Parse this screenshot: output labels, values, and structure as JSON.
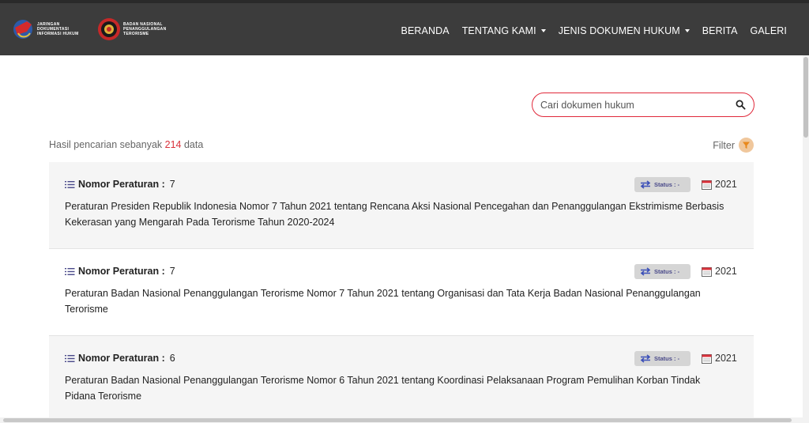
{
  "header": {
    "logo1_text": "JARINGAN DOKUMENTASI INFORMASI HUKUM",
    "logo2_text": "BADAN NASIONAL PENANGGULANGAN TERORISME",
    "nav": [
      "BERANDA",
      "TENTANG KAMI",
      "JENIS DOKUMEN HUKUM",
      "BERITA",
      "GALERI"
    ]
  },
  "search": {
    "placeholder": "Cari dokumen hukum"
  },
  "results": {
    "prefix": "Hasil pencarian sebanyak",
    "count": "214",
    "suffix": "data"
  },
  "filter": {
    "label": "Filter"
  },
  "cards": [
    {
      "label": "Nomor Peraturan :",
      "number": "7",
      "status": "Status : -",
      "year": "2021",
      "title": "Peraturan Presiden Republik Indonesia Nomor 7 Tahun 2021 tentang Rencana Aksi Nasional Pencegahan dan Penanggulangan Ekstrimisme Berbasis Kekerasan yang Mengarah Pada Terorisme Tahun 2020-2024"
    },
    {
      "label": "Nomor Peraturan :",
      "number": "7",
      "status": "Status : -",
      "year": "2021",
      "title": "Peraturan Badan Nasional Penanggulangan Terorisme Nomor 7 Tahun 2021 tentang Organisasi dan Tata Kerja Badan Nasional Penanggulangan Terorisme"
    },
    {
      "label": "Nomor Peraturan :",
      "number": "6",
      "status": "Status : -",
      "year": "2021",
      "title": "Peraturan Badan Nasional Penanggulangan Terorisme Nomor 6 Tahun 2021 tentang Koordinasi Pelaksanaan Program Pemulihan Korban Tindak Pidana Terorisme"
    }
  ],
  "colors": {
    "accent": "#d9313b",
    "header_bg": "#3c3c3c"
  }
}
